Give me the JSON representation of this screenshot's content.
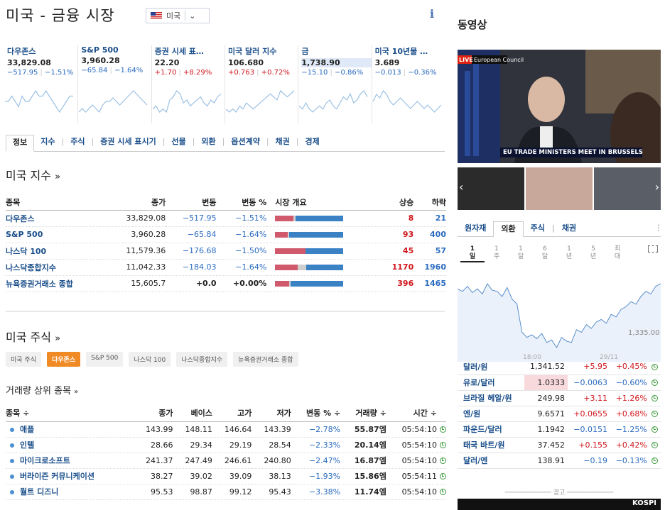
{
  "page": {
    "title": "미국 - 금융 시장",
    "country": "미국",
    "info": "i"
  },
  "tiles": [
    {
      "name": "다우존스",
      "value": "33,829.08",
      "chg": "−517.95",
      "pct": "−1.51%",
      "dir": "neg",
      "series": [
        5,
        5,
        6,
        5,
        4,
        6,
        5,
        5,
        6,
        7,
        6,
        6,
        7,
        6,
        5,
        4,
        3,
        4,
        5,
        6,
        6
      ]
    },
    {
      "name": "S&P 500",
      "value": "3,960.28",
      "chg": "−65.84",
      "pct": "−1.64%",
      "dir": "neg",
      "series": [
        2,
        3,
        2,
        3,
        4,
        3,
        2,
        4,
        5,
        5,
        6,
        5,
        4,
        5,
        6,
        7,
        8,
        7,
        6,
        5,
        4
      ]
    },
    {
      "name": "증권 시세 표…",
      "value": "22.20",
      "chg": "+1.70",
      "pct": "+8.29%",
      "dir": "pos",
      "series": [
        3,
        4,
        2,
        3,
        2,
        6,
        7,
        9,
        8,
        5,
        6,
        4,
        5,
        6,
        7,
        5,
        4,
        6,
        5,
        7,
        8
      ]
    },
    {
      "name": "미국 달러 지수",
      "value": "106.680",
      "chg": "+0.763",
      "pct": "+0.72%",
      "dir": "pos",
      "series": [
        3,
        2,
        3,
        2,
        4,
        3,
        5,
        4,
        3,
        4,
        5,
        6,
        7,
        8,
        7,
        6,
        9,
        8,
        7,
        8,
        9
      ]
    },
    {
      "name": "금",
      "value": "1,738.90",
      "chg": "−15.10",
      "pct": "−0.86%",
      "dir": "neg",
      "highlight": true,
      "series": [
        4,
        3,
        5,
        3,
        2,
        3,
        4,
        3,
        5,
        6,
        4,
        3,
        5,
        7,
        6,
        8,
        5,
        6,
        8,
        9,
        7
      ]
    },
    {
      "name": "미국 10년물 …",
      "value": "3.689",
      "chg": "−0.013",
      "pct": "−0.36%",
      "dir": "neg",
      "series": [
        6,
        8,
        7,
        9,
        8,
        6,
        5,
        6,
        7,
        6,
        5,
        4,
        5,
        6,
        5,
        4,
        5,
        4,
        3,
        4,
        5
      ]
    }
  ],
  "tabs": [
    "정보",
    "지수",
    "주식",
    "증권 시세 표시기",
    "선물",
    "외환",
    "옵션계약",
    "채권",
    "경제"
  ],
  "indices": {
    "heading": "미국 지수",
    "arrow": "»",
    "headers": [
      "종목",
      "종가",
      "변동",
      "변동 %",
      "시장 개요",
      "상승",
      "하락"
    ],
    "rows": [
      {
        "name": "다우존스",
        "close": "33,829.08",
        "chg": "−517.95",
        "pct": "−1.51%",
        "up": 8,
        "down": 21,
        "flat": 1
      },
      {
        "name": "S&P 500",
        "close": "3,960.28",
        "chg": "−65.84",
        "pct": "−1.64%",
        "up": 93,
        "down": 400,
        "flat": 10
      },
      {
        "name": "나스닥 100",
        "close": "11,579.36",
        "chg": "−176.68",
        "pct": "−1.50%",
        "up": 45,
        "down": 57,
        "flat": 0
      },
      {
        "name": "나스닥종합지수",
        "close": "11,042.33",
        "chg": "−184.03",
        "pct": "−1.64%",
        "up": 1170,
        "down": 1960,
        "flat": 450
      },
      {
        "name": "뉴욕증권거래소 종합",
        "close": "15,605.7",
        "chg": "+0.0",
        "pct": "+0.00%",
        "up": 396,
        "down": 1465,
        "flat": 40
      }
    ]
  },
  "stocks": {
    "heading": "미국 주식",
    "arrow": "»",
    "chips": [
      "미국 주식",
      "다우존스",
      "S&P 500",
      "나스닥 100",
      "나스닥종합지수",
      "뉴욕증권거래소 종합"
    ],
    "selected_chip": 1,
    "subheading": "거래량 상위 종목",
    "sub_arrow": "»",
    "headers": [
      "종목 ÷",
      "종가",
      "베이스",
      "고가",
      "저가",
      "변동 % ÷",
      "거래량 ÷",
      "시간 ÷"
    ],
    "rows": [
      [
        "애플",
        "143.99",
        "148.11",
        "146.64",
        "143.39",
        "−2.78%",
        "55.87엠",
        "05:54:10"
      ],
      [
        "인텔",
        "28.66",
        "29.34",
        "29.19",
        "28.54",
        "−2.33%",
        "20.14엠",
        "05:54:10"
      ],
      [
        "마이크로소프트",
        "241.37",
        "247.49",
        "246.61",
        "240.80",
        "−2.47%",
        "16.87엠",
        "05:54:10"
      ],
      [
        "버라이즌 커뮤니케이션",
        "38.27",
        "39.02",
        "39.09",
        "38.13",
        "−1.93%",
        "15.86엠",
        "05:54:11"
      ],
      [
        "월트 디즈니",
        "95.53",
        "98.87",
        "99.12",
        "95.43",
        "−3.38%",
        "11.74엠",
        "05:54:10"
      ]
    ]
  },
  "video": {
    "heading": "동영상",
    "live": "LIVE",
    "source": "European Council",
    "caption": "EU TRADE MINISTERS MEET IN BRUSSELS"
  },
  "fx": {
    "tabs": [
      "원자재",
      "외환",
      "주식",
      "채권"
    ],
    "selected_tab": 1,
    "periods": [
      "1 일",
      "1 주",
      "1 달",
      "6 달",
      "1 년",
      "5 년",
      "최 대"
    ],
    "chart": {
      "label": "1,335.00",
      "x_labels": [
        "18:00",
        "29/11"
      ],
      "series": [
        72,
        70,
        74,
        69,
        72,
        68,
        76,
        71,
        70,
        66,
        73,
        64,
        60,
        38,
        34,
        36,
        33,
        37,
        30,
        32,
        26,
        34,
        31,
        30,
        40,
        38,
        44,
        41,
        46,
        48,
        45,
        52,
        50,
        56,
        58,
        62,
        60,
        66,
        70,
        68,
        74,
        76
      ]
    },
    "rows": [
      [
        "달러/원",
        "1,341.52",
        "+5.95",
        "+0.45%"
      ],
      [
        "유로/달러",
        "1.0333",
        "−0.0063",
        "−0.60%"
      ],
      [
        "브라질 헤알/원",
        "249.98",
        "+3.11",
        "+1.26%"
      ],
      [
        "엔/원",
        "9.6571",
        "+0.0655",
        "+0.68%"
      ],
      [
        "파운드/달러",
        "1.1942",
        "−0.0151",
        "−1.25%"
      ],
      [
        "태국 바트/원",
        "37.452",
        "+0.155",
        "+0.42%"
      ],
      [
        "달러/엔",
        "138.91",
        "−0.19",
        "−0.13%"
      ]
    ],
    "highlight_row": 1
  },
  "ad": {
    "label": "광고",
    "brand": "KOSPI"
  }
}
